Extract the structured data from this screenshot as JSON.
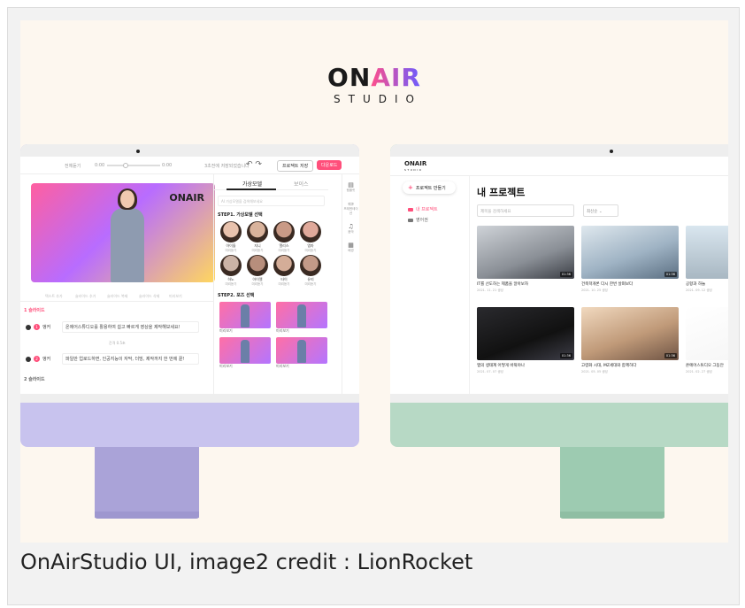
{
  "logo": {
    "on": "ON",
    "air": "AIR",
    "studio": "STUDIO"
  },
  "editor": {
    "zoom_label": "전체듣기",
    "zoom_start": "0:00",
    "zoom_end": "0:00",
    "saved_text": "3초전에 저장되었습니다",
    "undo_icon": "↶ ↷",
    "save_button": "프로젝트 저장",
    "download_button": "다운로드",
    "preview_logo": "ONAIR",
    "toolbar_items": [
      "텍스트 추가",
      "슬라이드 추가",
      "슬라이드 복제",
      "슬라이드 삭제",
      "미리보기"
    ],
    "slide1_label": "1 슬라이드",
    "slide2_label": "2 슬라이드",
    "rows": [
      {
        "num": "1",
        "role": "앵커",
        "text": "온에어스튜디오를 활용하여 쉽고 빠르게 영상을 제작해보세요!"
      },
      {
        "num": "2",
        "role": "앵커",
        "text": "파일만 업로드하면, 인공지능이 자막, 더빙, 제작까지 한 번에 끝!"
      }
    ],
    "between_text": "간격 0.5초",
    "panel": {
      "tab_active": "가상모델",
      "tab_other": "보이스",
      "search_placeholder": "AI 가상모델을 검색해보세요",
      "step1": "STEP1. 가상모델 선택",
      "step2": "STEP2. 포즈 선택",
      "models": [
        {
          "name": "아이돌",
          "sub": "미리듣기",
          "color": "#e8c2ad"
        },
        {
          "name": "지니",
          "sub": "미리듣기",
          "color": "#d9b39c"
        },
        {
          "name": "엘리스",
          "sub": "미리듣기",
          "color": "#c99a86"
        },
        {
          "name": "엠마",
          "sub": "미리듣기",
          "color": "#e0a99a"
        },
        {
          "name": "하노",
          "sub": "미리듣기",
          "color": "#cbb3a6"
        },
        {
          "name": "아이엘",
          "sub": "미리듣기",
          "color": "#b78e7c"
        },
        {
          "name": "타이",
          "sub": "미리듣기",
          "color": "#d4ad98"
        },
        {
          "name": "유리",
          "sub": "미리듣기",
          "color": "#c39a88"
        }
      ],
      "poses": [
        "미리보기",
        "미리보기",
        "미리보기",
        "미리보기"
      ]
    },
    "rail": [
      "템플릿",
      "프레젠테이션",
      "음악",
      "배경"
    ]
  },
  "projects": {
    "logo": "ONAIR",
    "logo_sub": "STUDIO",
    "new_button": "프로젝트 만들기",
    "nav": [
      "내 프로젝트",
      "영어권"
    ],
    "title": "내 프로젝트",
    "search_placeholder": "제목을 검색하세요",
    "sort": "최신순",
    "cards": [
      {
        "title": "IT를 선도하는 제품을 알아보자",
        "date": "2021. 11. 21 생성",
        "duration": "01:36",
        "bg": "linear-gradient(160deg,#cfd3d8,#8a8f96 60%,#3a3d44)"
      },
      {
        "title": "건축학개론 다시 한번 살펴보다",
        "date": "2021. 10. 25 생성",
        "duration": "01:36",
        "bg": "linear-gradient(160deg,#dfe8ee,#9fb3c4 55%,#5b6f82)"
      },
      {
        "title": "공항과 하늘",
        "date": "2021. 09. 12 생성",
        "duration": "",
        "bg": "linear-gradient(180deg,#d9e6ef,#a8b7c2)"
      },
      {
        "title": "앱의 생태계 어떻게 바꿔야나",
        "date": "2021. 07. 07 생성",
        "duration": "01:36",
        "bg": "linear-gradient(160deg,#2a2a2e,#111 60%,#3e3e48)"
      },
      {
        "title": "고령화 시대, MZ세대와 함께하다",
        "date": "2021. 05. 05 생성",
        "duration": "01:36",
        "bg": "linear-gradient(160deg,#f1d9bf,#c09a79 55%,#6f5444)"
      },
      {
        "title": "온에어스튜디오 그동안",
        "date": "2021. 02. 27 생성",
        "duration": "",
        "bg": "linear-gradient(160deg,#ffffff,#f4f4f4)"
      }
    ]
  },
  "caption": "OnAirStudio UI, image2 credit : LionRocket"
}
